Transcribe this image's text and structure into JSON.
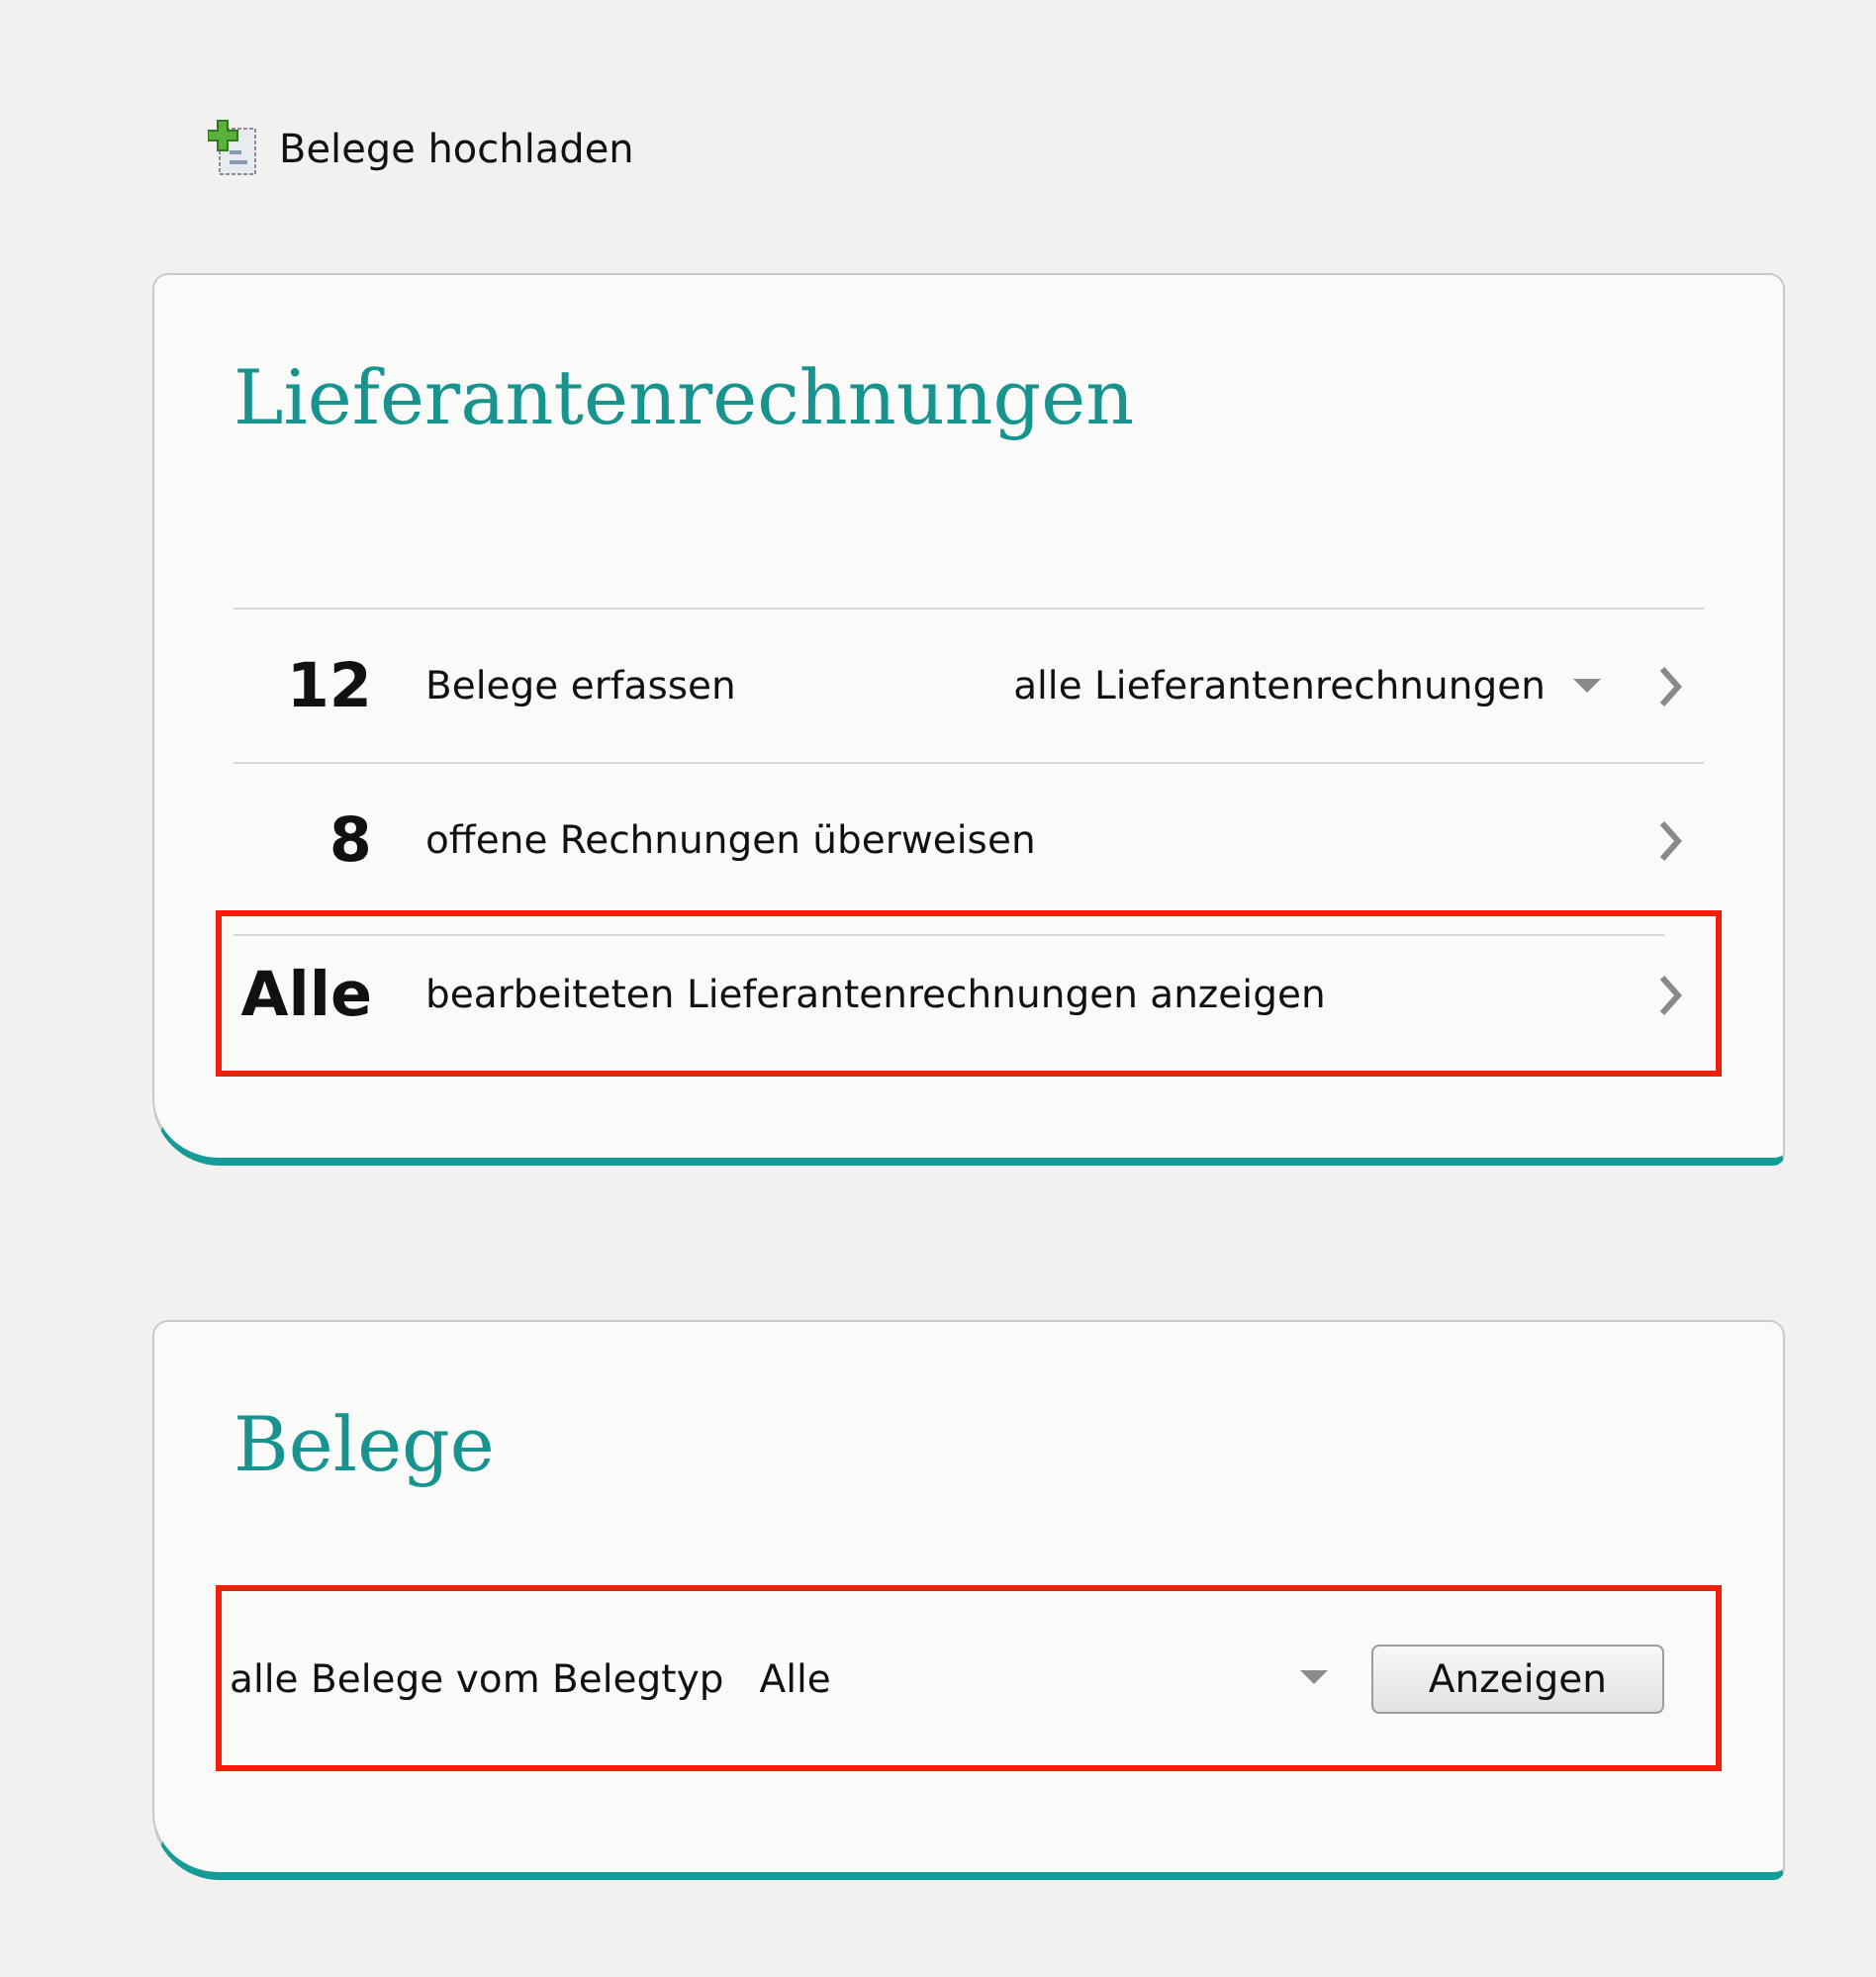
{
  "upload_link": {
    "label": "Belege hochladen"
  },
  "invoices_card": {
    "title": "Lieferantenrechnungen",
    "rows": [
      {
        "count": "12",
        "label": "Belege erfassen",
        "dropdown": {
          "value": "alle Lieferantenrechnungen"
        },
        "highlighted": false
      },
      {
        "count": "8",
        "label": "offene Rechnungen überweisen",
        "highlighted": false
      },
      {
        "count": "Alle",
        "label": "bearbeiteten Lieferantenrechnungen anzeigen",
        "highlighted": true
      }
    ]
  },
  "receipts_card": {
    "title": "Belege",
    "filter": {
      "label": "alle Belege vom Belegtyp",
      "value": "Alle",
      "button": "Anzeigen",
      "highlighted": true
    }
  }
}
